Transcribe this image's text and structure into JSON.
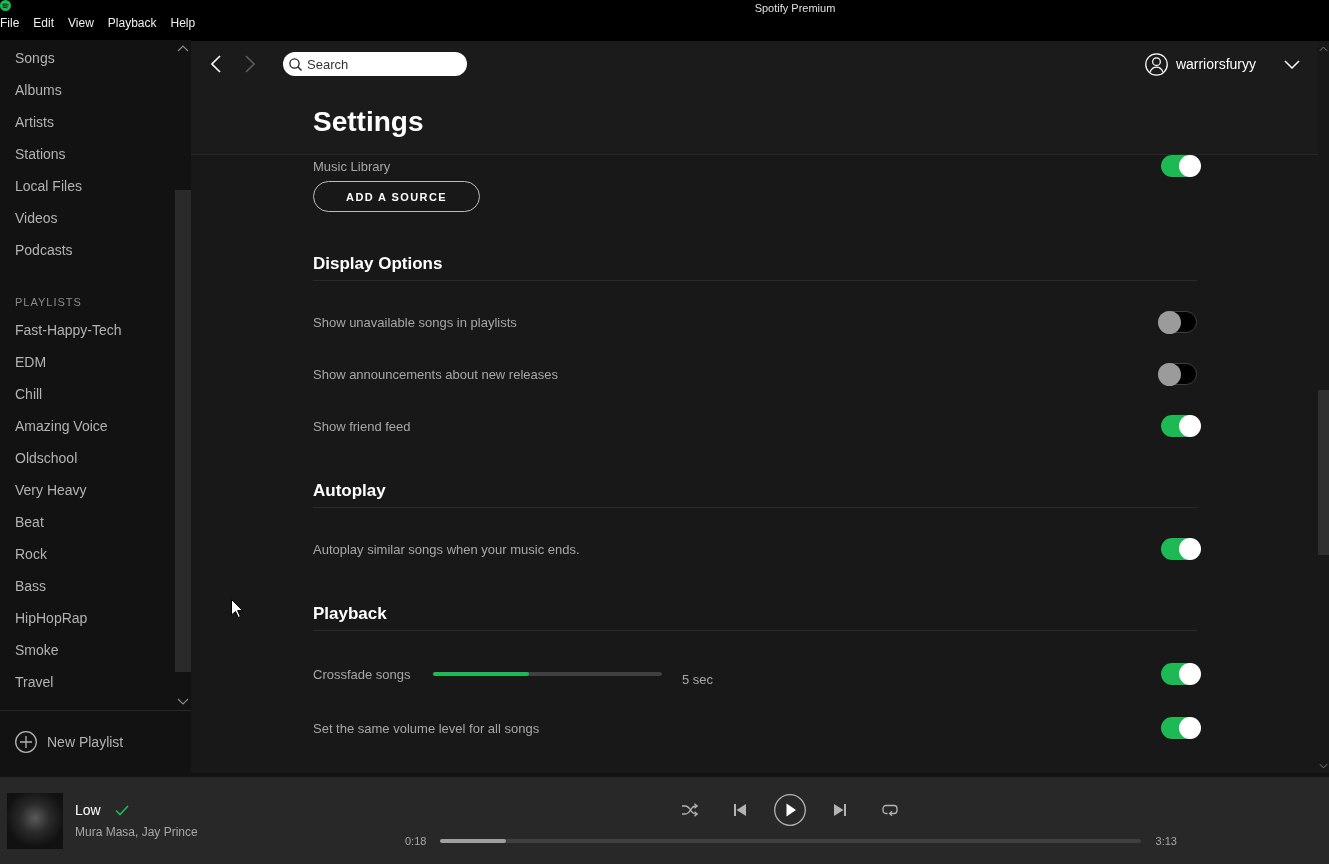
{
  "window": {
    "title": "Spotify Premium"
  },
  "menu_bar": [
    "File",
    "Edit",
    "View",
    "Playback",
    "Help"
  ],
  "sidebar": {
    "library": [
      {
        "label": "Songs",
        "selected": false
      },
      {
        "label": "Albums",
        "selected": false
      },
      {
        "label": "Artists",
        "selected": false
      },
      {
        "label": "Stations",
        "selected": false
      },
      {
        "label": "Local Files",
        "selected": false
      },
      {
        "label": "Videos",
        "selected": false
      },
      {
        "label": "Podcasts",
        "selected": false
      }
    ],
    "playlists_heading": "PLAYLISTS",
    "playlists": [
      {
        "label": "Fast-Happy-Tech",
        "selected": false
      },
      {
        "label": "EDM",
        "selected": false
      },
      {
        "label": "Chill",
        "selected": false
      },
      {
        "label": "Amazing Voice",
        "selected": false
      },
      {
        "label": "Oldschool",
        "selected": false
      },
      {
        "label": "Very Heavy",
        "selected": false
      },
      {
        "label": "Beat",
        "selected": false
      },
      {
        "label": "Rock",
        "selected": false
      },
      {
        "label": "Bass",
        "selected": false
      },
      {
        "label": "HipHopRap",
        "selected": false
      },
      {
        "label": "Smoke",
        "selected": false
      },
      {
        "label": "Travel",
        "selected": false
      }
    ],
    "new_playlist": "New Playlist"
  },
  "header": {
    "nav": {
      "back": {
        "disabled": false
      },
      "forward": {
        "disabled": true
      }
    },
    "search": {
      "placeholder": "Search"
    },
    "user": {
      "name": "warriorsfuryy"
    },
    "title": "Settings"
  },
  "settings": {
    "top_rows": [
      {
        "kind": "toggle",
        "label": "Music Library",
        "on": true
      }
    ],
    "add_source_button": "ADD A SOURCE",
    "sections": [
      {
        "heading": "Display Options",
        "rows": [
          {
            "kind": "toggle",
            "label": "Show unavailable songs in playlists",
            "on": false
          },
          {
            "kind": "toggle",
            "label": "Show announcements about new releases",
            "on": false
          },
          {
            "kind": "toggle",
            "label": "Show friend feed",
            "on": true
          }
        ]
      },
      {
        "heading": "Autoplay",
        "rows": [
          {
            "kind": "toggle",
            "label": "Autoplay similar songs when your music ends.",
            "on": true
          }
        ]
      },
      {
        "heading": "Playback",
        "rows": [
          {
            "kind": "slider",
            "label": "Crossfade songs",
            "level": 0.42,
            "reading": "5 sec",
            "on": true
          },
          {
            "kind": "toggle",
            "label": "Set the same volume level for all songs",
            "on": true
          }
        ]
      }
    ]
  },
  "player": {
    "track": {
      "title": "Low",
      "saved": true,
      "artists": "Mura Masa, Jay Prince"
    },
    "controls": {
      "shuffle": false,
      "playing": false,
      "repeat": false
    },
    "progress": {
      "elapsed": "0:18",
      "level": 0.093,
      "duration": "3:13"
    }
  }
}
